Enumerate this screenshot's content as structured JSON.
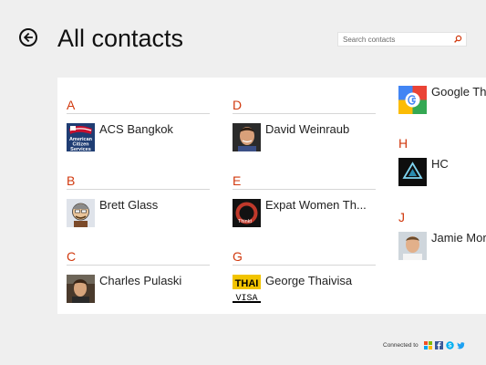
{
  "header": {
    "title": "All contacts"
  },
  "search": {
    "placeholder": "Search contacts"
  },
  "columns": [
    [
      {
        "letter": "A",
        "contact": {
          "name": "ACS Bangkok",
          "avatar": "american-citizen-services-logo"
        }
      },
      {
        "letter": "B",
        "contact": {
          "name": "Brett Glass",
          "avatar": "cartoon-person-avatar"
        }
      },
      {
        "letter": "C",
        "contact": {
          "name": "Charles Pulaski",
          "avatar": "person-photo-avatar"
        }
      }
    ],
    [
      {
        "letter": "D",
        "contact": {
          "name": "David Weinraub",
          "avatar": "person-photo-avatar"
        }
      },
      {
        "letter": "E",
        "contact": {
          "name": "Expat Women Th...",
          "avatar": "red-circle-logo"
        }
      },
      {
        "letter": "G",
        "contact": {
          "name": "George Thaivisa",
          "avatar": "thaivisa-logo"
        }
      }
    ],
    [
      {
        "letter": "",
        "contact": {
          "name": "Google Th",
          "avatar": "google-plus-logo"
        }
      },
      {
        "letter": "H",
        "contact": {
          "name": "HC",
          "avatar": "hc-logo"
        }
      },
      {
        "letter": "J",
        "contact": {
          "name": "Jamie Mor",
          "avatar": "person-photo-avatar"
        }
      }
    ]
  ],
  "avatar_text": {
    "acs": "American Citizen Services",
    "expat": "Thinkt",
    "thaivisa_top": "THAI",
    "thaivisa_bottom": "VISA"
  },
  "footer": {
    "label": "Connected to",
    "services": [
      "windows-icon",
      "facebook-icon",
      "skype-icon",
      "twitter-icon"
    ]
  },
  "colors": {
    "accent": "#d1390e",
    "background": "#efefef",
    "panel": "#ffffff"
  }
}
